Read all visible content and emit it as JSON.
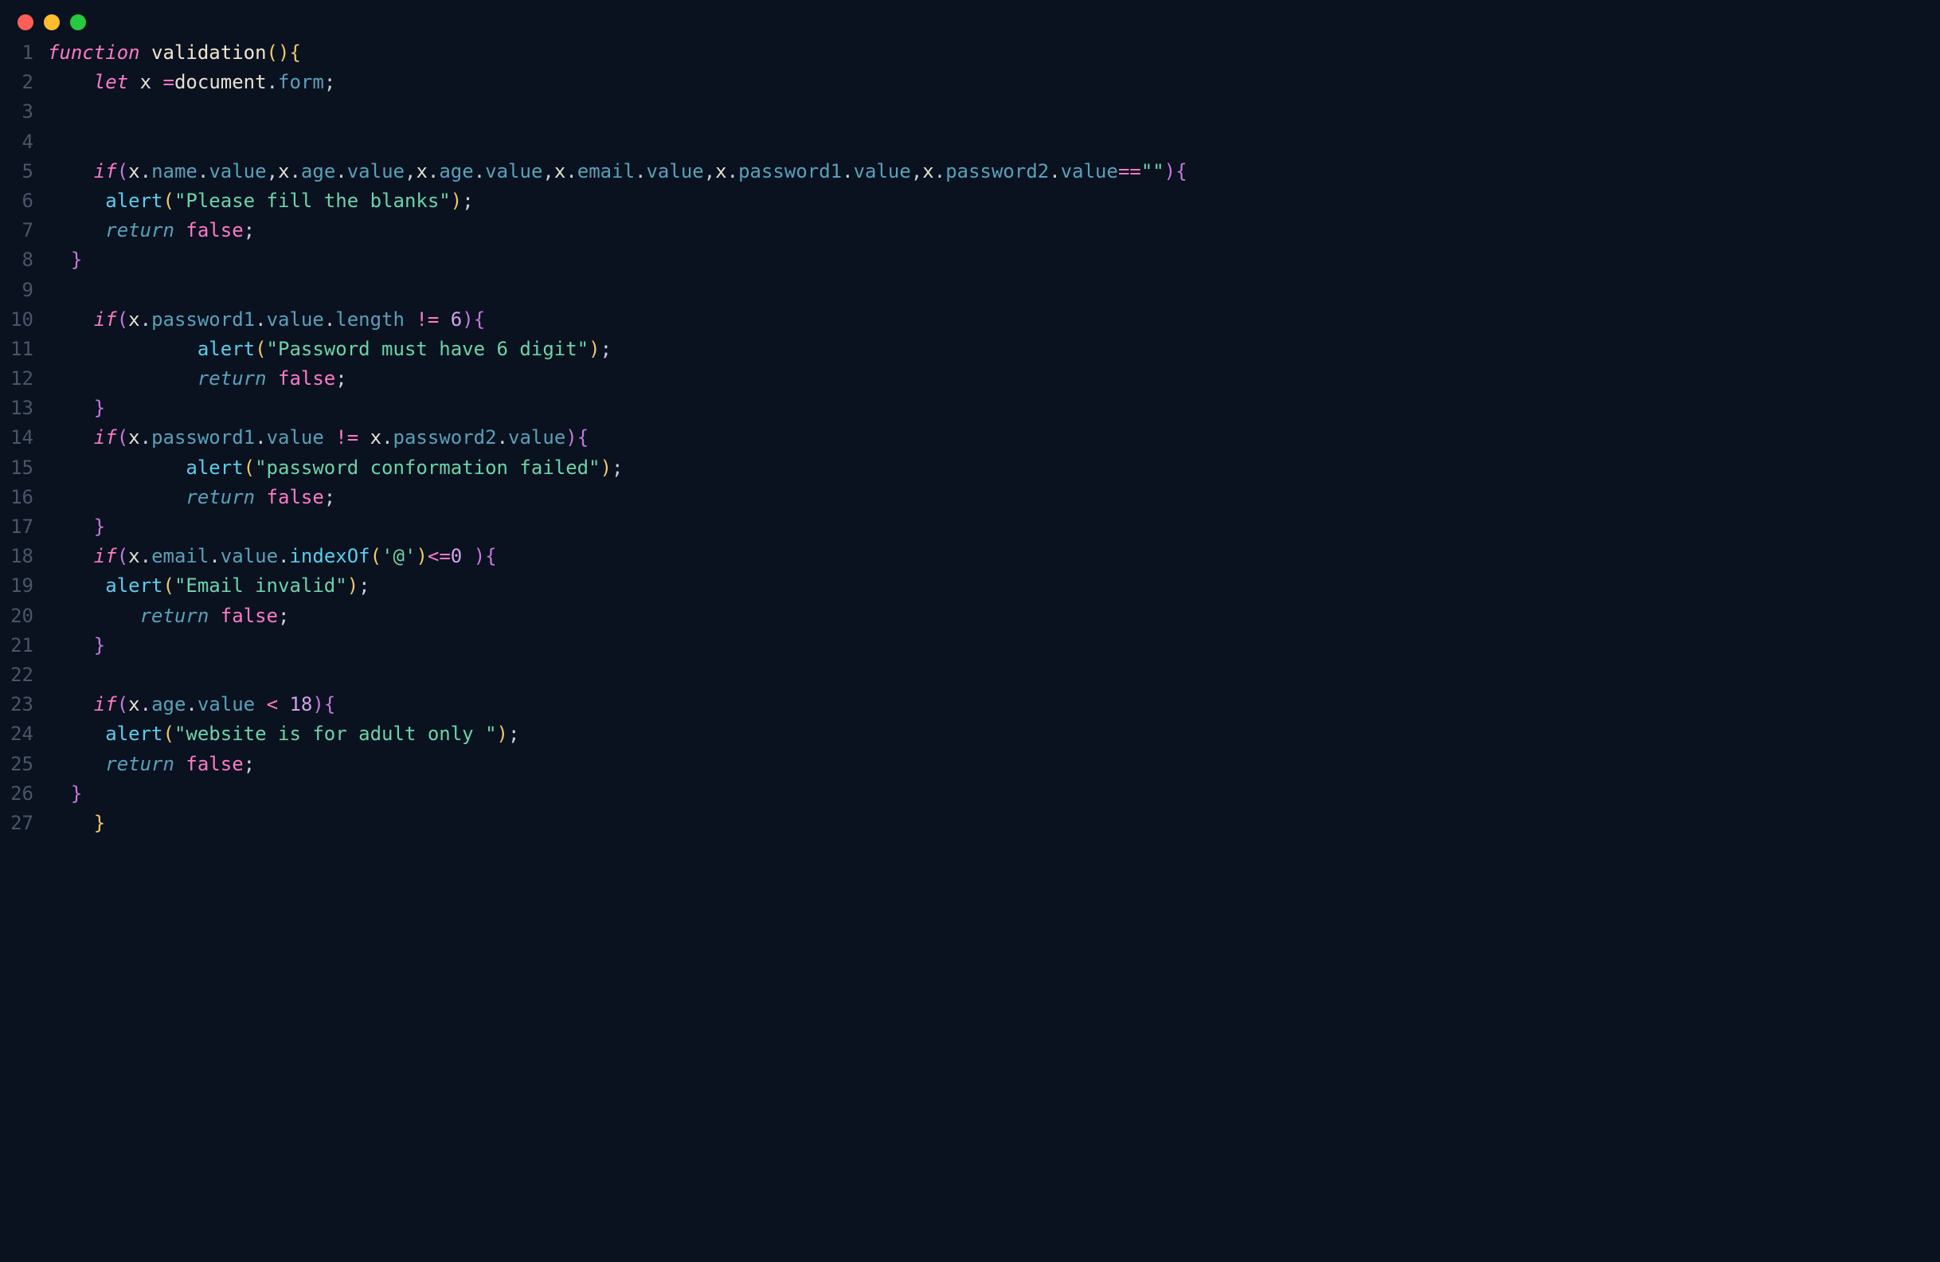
{
  "traffic_lights": [
    "close",
    "minimize",
    "maximize"
  ],
  "code": {
    "lines": [
      {
        "n": 1,
        "tokens": [
          {
            "t": "function",
            "c": "tok-keyword"
          },
          {
            "t": " ",
            "c": ""
          },
          {
            "t": "validation",
            "c": "tok-fnname"
          },
          {
            "t": "(){",
            "c": "tok-paren"
          }
        ]
      },
      {
        "n": 2,
        "tokens": [
          {
            "t": "    ",
            "c": ""
          },
          {
            "t": "let",
            "c": "tok-let"
          },
          {
            "t": " ",
            "c": ""
          },
          {
            "t": "x",
            "c": "tok-var"
          },
          {
            "t": " ",
            "c": ""
          },
          {
            "t": "=",
            "c": "tok-op"
          },
          {
            "t": "document",
            "c": "tok-var"
          },
          {
            "t": ".",
            "c": "tok-punct"
          },
          {
            "t": "form",
            "c": "tok-prop"
          },
          {
            "t": ";",
            "c": "tok-punct"
          }
        ]
      },
      {
        "n": 3,
        "tokens": []
      },
      {
        "n": 4,
        "tokens": []
      },
      {
        "n": 5,
        "tokens": [
          {
            "t": "    ",
            "c": ""
          },
          {
            "t": "if",
            "c": "tok-keyword"
          },
          {
            "t": "(",
            "c": "tok-paren2"
          },
          {
            "t": "x",
            "c": "tok-var"
          },
          {
            "t": ".",
            "c": "tok-punct"
          },
          {
            "t": "name",
            "c": "tok-prop"
          },
          {
            "t": ".",
            "c": "tok-punct"
          },
          {
            "t": "value",
            "c": "tok-prop"
          },
          {
            "t": ",",
            "c": "tok-punct"
          },
          {
            "t": "x",
            "c": "tok-var"
          },
          {
            "t": ".",
            "c": "tok-punct"
          },
          {
            "t": "age",
            "c": "tok-prop"
          },
          {
            "t": ".",
            "c": "tok-punct"
          },
          {
            "t": "value",
            "c": "tok-prop"
          },
          {
            "t": ",",
            "c": "tok-punct"
          },
          {
            "t": "x",
            "c": "tok-var"
          },
          {
            "t": ".",
            "c": "tok-punct"
          },
          {
            "t": "age",
            "c": "tok-prop"
          },
          {
            "t": ".",
            "c": "tok-punct"
          },
          {
            "t": "value",
            "c": "tok-prop"
          },
          {
            "t": ",",
            "c": "tok-punct"
          },
          {
            "t": "x",
            "c": "tok-var"
          },
          {
            "t": ".",
            "c": "tok-punct"
          },
          {
            "t": "email",
            "c": "tok-prop"
          },
          {
            "t": ".",
            "c": "tok-punct"
          },
          {
            "t": "value",
            "c": "tok-prop"
          },
          {
            "t": ",",
            "c": "tok-punct"
          },
          {
            "t": "x",
            "c": "tok-var"
          },
          {
            "t": ".",
            "c": "tok-punct"
          },
          {
            "t": "password1",
            "c": "tok-prop"
          },
          {
            "t": ".",
            "c": "tok-punct"
          },
          {
            "t": "value",
            "c": "tok-prop"
          },
          {
            "t": ",",
            "c": "tok-punct"
          },
          {
            "t": "x",
            "c": "tok-var"
          },
          {
            "t": ".",
            "c": "tok-punct"
          },
          {
            "t": "password2",
            "c": "tok-prop"
          },
          {
            "t": ".",
            "c": "tok-punct"
          },
          {
            "t": "value",
            "c": "tok-prop"
          },
          {
            "t": "==",
            "c": "tok-op"
          },
          {
            "t": "\"\"",
            "c": "tok-string"
          },
          {
            "t": ")",
            "c": "tok-paren2"
          },
          {
            "t": "{",
            "c": "tok-paren2"
          }
        ]
      },
      {
        "n": 6,
        "tokens": [
          {
            "t": "     ",
            "c": ""
          },
          {
            "t": "alert",
            "c": "tok-method"
          },
          {
            "t": "(",
            "c": "tok-paren"
          },
          {
            "t": "\"Please fill the blanks\"",
            "c": "tok-string"
          },
          {
            "t": ")",
            "c": "tok-paren"
          },
          {
            "t": ";",
            "c": "tok-punct"
          }
        ]
      },
      {
        "n": 7,
        "tokens": [
          {
            "t": "     ",
            "c": ""
          },
          {
            "t": "return",
            "c": "tok-return"
          },
          {
            "t": " ",
            "c": ""
          },
          {
            "t": "false",
            "c": "tok-bool"
          },
          {
            "t": ";",
            "c": "tok-punct"
          }
        ]
      },
      {
        "n": 8,
        "tokens": [
          {
            "t": "  ",
            "c": ""
          },
          {
            "t": "}",
            "c": "tok-paren2"
          }
        ]
      },
      {
        "n": 9,
        "tokens": []
      },
      {
        "n": 10,
        "tokens": [
          {
            "t": "    ",
            "c": ""
          },
          {
            "t": "if",
            "c": "tok-keyword"
          },
          {
            "t": "(",
            "c": "tok-paren2"
          },
          {
            "t": "x",
            "c": "tok-var"
          },
          {
            "t": ".",
            "c": "tok-punct"
          },
          {
            "t": "password1",
            "c": "tok-prop"
          },
          {
            "t": ".",
            "c": "tok-punct"
          },
          {
            "t": "value",
            "c": "tok-prop"
          },
          {
            "t": ".",
            "c": "tok-punct"
          },
          {
            "t": "length",
            "c": "tok-prop"
          },
          {
            "t": " ",
            "c": ""
          },
          {
            "t": "!=",
            "c": "tok-op"
          },
          {
            "t": " ",
            "c": ""
          },
          {
            "t": "6",
            "c": "tok-number"
          },
          {
            "t": ")",
            "c": "tok-paren2"
          },
          {
            "t": "{",
            "c": "tok-paren2"
          }
        ]
      },
      {
        "n": 11,
        "tokens": [
          {
            "t": "             ",
            "c": ""
          },
          {
            "t": "alert",
            "c": "tok-method"
          },
          {
            "t": "(",
            "c": "tok-paren"
          },
          {
            "t": "\"Password must have 6 digit\"",
            "c": "tok-string"
          },
          {
            "t": ")",
            "c": "tok-paren"
          },
          {
            "t": ";",
            "c": "tok-punct"
          }
        ]
      },
      {
        "n": 12,
        "tokens": [
          {
            "t": "             ",
            "c": ""
          },
          {
            "t": "return",
            "c": "tok-return"
          },
          {
            "t": " ",
            "c": ""
          },
          {
            "t": "false",
            "c": "tok-bool"
          },
          {
            "t": ";",
            "c": "tok-punct"
          }
        ]
      },
      {
        "n": 13,
        "tokens": [
          {
            "t": "    ",
            "c": ""
          },
          {
            "t": "}",
            "c": "tok-paren2"
          }
        ]
      },
      {
        "n": 14,
        "tokens": [
          {
            "t": "    ",
            "c": ""
          },
          {
            "t": "if",
            "c": "tok-keyword"
          },
          {
            "t": "(",
            "c": "tok-paren2"
          },
          {
            "t": "x",
            "c": "tok-var"
          },
          {
            "t": ".",
            "c": "tok-punct"
          },
          {
            "t": "password1",
            "c": "tok-prop"
          },
          {
            "t": ".",
            "c": "tok-punct"
          },
          {
            "t": "value",
            "c": "tok-prop"
          },
          {
            "t": " ",
            "c": ""
          },
          {
            "t": "!=",
            "c": "tok-op"
          },
          {
            "t": " ",
            "c": ""
          },
          {
            "t": "x",
            "c": "tok-var"
          },
          {
            "t": ".",
            "c": "tok-punct"
          },
          {
            "t": "password2",
            "c": "tok-prop"
          },
          {
            "t": ".",
            "c": "tok-punct"
          },
          {
            "t": "value",
            "c": "tok-prop"
          },
          {
            "t": ")",
            "c": "tok-paren2"
          },
          {
            "t": "{",
            "c": "tok-paren2"
          }
        ]
      },
      {
        "n": 15,
        "tokens": [
          {
            "t": "            ",
            "c": ""
          },
          {
            "t": "alert",
            "c": "tok-method"
          },
          {
            "t": "(",
            "c": "tok-paren"
          },
          {
            "t": "\"password conformation failed\"",
            "c": "tok-string"
          },
          {
            "t": ")",
            "c": "tok-paren"
          },
          {
            "t": ";",
            "c": "tok-punct"
          }
        ]
      },
      {
        "n": 16,
        "tokens": [
          {
            "t": "            ",
            "c": ""
          },
          {
            "t": "return",
            "c": "tok-return"
          },
          {
            "t": " ",
            "c": ""
          },
          {
            "t": "false",
            "c": "tok-bool"
          },
          {
            "t": ";",
            "c": "tok-punct"
          }
        ]
      },
      {
        "n": 17,
        "tokens": [
          {
            "t": "    ",
            "c": ""
          },
          {
            "t": "}",
            "c": "tok-paren2"
          }
        ]
      },
      {
        "n": 18,
        "tokens": [
          {
            "t": "    ",
            "c": ""
          },
          {
            "t": "if",
            "c": "tok-keyword"
          },
          {
            "t": "(",
            "c": "tok-paren2"
          },
          {
            "t": "x",
            "c": "tok-var"
          },
          {
            "t": ".",
            "c": "tok-punct"
          },
          {
            "t": "email",
            "c": "tok-prop"
          },
          {
            "t": ".",
            "c": "tok-punct"
          },
          {
            "t": "value",
            "c": "tok-prop"
          },
          {
            "t": ".",
            "c": "tok-punct"
          },
          {
            "t": "indexOf",
            "c": "tok-method"
          },
          {
            "t": "(",
            "c": "tok-paren"
          },
          {
            "t": "'@'",
            "c": "tok-string"
          },
          {
            "t": ")",
            "c": "tok-paren"
          },
          {
            "t": "<=",
            "c": "tok-op"
          },
          {
            "t": "0",
            "c": "tok-number"
          },
          {
            "t": " ",
            "c": ""
          },
          {
            "t": ")",
            "c": "tok-paren2"
          },
          {
            "t": "{",
            "c": "tok-paren2"
          }
        ]
      },
      {
        "n": 19,
        "tokens": [
          {
            "t": "     ",
            "c": ""
          },
          {
            "t": "alert",
            "c": "tok-method"
          },
          {
            "t": "(",
            "c": "tok-paren"
          },
          {
            "t": "\"Email invalid\"",
            "c": "tok-string"
          },
          {
            "t": ")",
            "c": "tok-paren"
          },
          {
            "t": ";",
            "c": "tok-punct"
          }
        ]
      },
      {
        "n": 20,
        "tokens": [
          {
            "t": "        ",
            "c": ""
          },
          {
            "t": "return",
            "c": "tok-return"
          },
          {
            "t": " ",
            "c": ""
          },
          {
            "t": "false",
            "c": "tok-bool"
          },
          {
            "t": ";",
            "c": "tok-punct"
          }
        ]
      },
      {
        "n": 21,
        "tokens": [
          {
            "t": "    ",
            "c": ""
          },
          {
            "t": "}",
            "c": "tok-paren2"
          }
        ]
      },
      {
        "n": 22,
        "tokens": []
      },
      {
        "n": 23,
        "tokens": [
          {
            "t": "    ",
            "c": ""
          },
          {
            "t": "if",
            "c": "tok-keyword"
          },
          {
            "t": "(",
            "c": "tok-paren2"
          },
          {
            "t": "x",
            "c": "tok-var"
          },
          {
            "t": ".",
            "c": "tok-punct"
          },
          {
            "t": "age",
            "c": "tok-prop"
          },
          {
            "t": ".",
            "c": "tok-punct"
          },
          {
            "t": "value",
            "c": "tok-prop"
          },
          {
            "t": " ",
            "c": ""
          },
          {
            "t": "<",
            "c": "tok-op"
          },
          {
            "t": " ",
            "c": ""
          },
          {
            "t": "18",
            "c": "tok-number"
          },
          {
            "t": ")",
            "c": "tok-paren2"
          },
          {
            "t": "{",
            "c": "tok-paren2"
          }
        ]
      },
      {
        "n": 24,
        "tokens": [
          {
            "t": "     ",
            "c": ""
          },
          {
            "t": "alert",
            "c": "tok-method"
          },
          {
            "t": "(",
            "c": "tok-paren"
          },
          {
            "t": "\"website is for adult only \"",
            "c": "tok-string"
          },
          {
            "t": ")",
            "c": "tok-paren"
          },
          {
            "t": ";",
            "c": "tok-punct"
          }
        ]
      },
      {
        "n": 25,
        "tokens": [
          {
            "t": "     ",
            "c": ""
          },
          {
            "t": "return",
            "c": "tok-return"
          },
          {
            "t": " ",
            "c": ""
          },
          {
            "t": "false",
            "c": "tok-bool"
          },
          {
            "t": ";",
            "c": "tok-punct"
          }
        ]
      },
      {
        "n": 26,
        "tokens": [
          {
            "t": "  ",
            "c": ""
          },
          {
            "t": "}",
            "c": "tok-paren2"
          }
        ]
      },
      {
        "n": 27,
        "tokens": [
          {
            "t": "    ",
            "c": ""
          },
          {
            "t": "}",
            "c": "tok-paren"
          }
        ]
      }
    ]
  }
}
